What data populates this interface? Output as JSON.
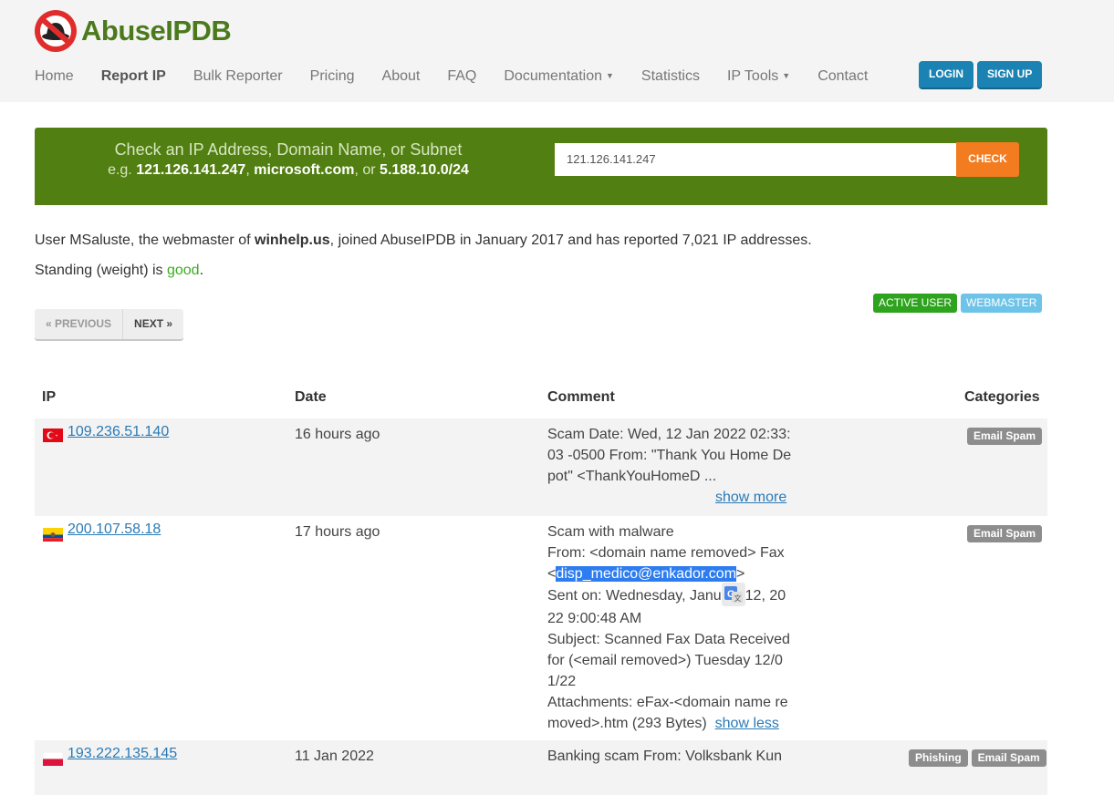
{
  "brand": {
    "name": "AbuseIPDB",
    "accent": "#4b7a1c"
  },
  "nav": {
    "items": [
      {
        "label": "Home"
      },
      {
        "label": "Report IP",
        "active": true
      },
      {
        "label": "Bulk Reporter"
      },
      {
        "label": "Pricing"
      },
      {
        "label": "About"
      },
      {
        "label": "FAQ"
      },
      {
        "label": "Documentation",
        "dropdown": true
      },
      {
        "label": "Statistics"
      },
      {
        "label": "IP Tools",
        "dropdown": true
      },
      {
        "label": "Contact"
      }
    ],
    "login": "LOGIN",
    "signup": "SIGN UP"
  },
  "check": {
    "title": "Check an IP Address, Domain Name, or Subnet",
    "example_prefix": "e.g.",
    "example_ip": "121.126.141.247",
    "example_domain": "microsoft.com",
    "example_or": ", or",
    "example_subnet": "5.188.10.0/24",
    "input_value": "121.126.141.247",
    "button": "CHECK",
    "band_color": "#527f12",
    "button_color": "#f47c20"
  },
  "user": {
    "prefix": "User MSaluste, the webmaster of",
    "site": "winhelp.us",
    "suffix": ", joined AbuseIPDB in January 2017 and has reported 7,021 IP addresses.",
    "standing_prefix": "Standing (weight) is",
    "standing_value": "good",
    "badges": [
      "ACTIVE USER",
      "WEBMASTER"
    ]
  },
  "pager": {
    "previous": "« PREVIOUS",
    "next": "NEXT »"
  },
  "table": {
    "headers": {
      "ip": "IP",
      "date": "Date",
      "comment": "Comment",
      "categories": "Categories"
    },
    "rows": [
      {
        "ip": "109.236.51.140",
        "flag": "turkey",
        "date": "16 hours ago",
        "comment": "Scam Date: Wed, 12 Jan 2022 02:33:03 -0500 From: \"Thank You Home Depot\" <ThankYouHomeD ...",
        "toggle": "show more",
        "categories": [
          "Email Spam"
        ]
      },
      {
        "ip": "200.107.58.18",
        "flag": "ecuador",
        "date": "17 hours ago",
        "comment_lines": {
          "l1": "Scam with malware",
          "l2": "From: <domain name removed> Fax",
          "l3_pre": "<",
          "l3_email": "disp_medico@enkador.com",
          "l3_post": ">",
          "l4a": "Sent on: Wednesday, Janu",
          "l4b": "12, 2022 9:00:48 AM",
          "l5": "Subject: Scanned Fax Data Received for (<email removed>) Tuesday 12/01/22",
          "l6": "Attachments: eFax-<domain name removed>.htm (293 Bytes)"
        },
        "toggle": "show less",
        "categories": [
          "Email Spam"
        ]
      },
      {
        "ip": "193.222.135.145",
        "flag": "poland",
        "date": "11 Jan 2022",
        "comment": "Banking scam From: Volksbank Kun",
        "categories": [
          "Phishing",
          "Email Spam"
        ]
      }
    ]
  }
}
